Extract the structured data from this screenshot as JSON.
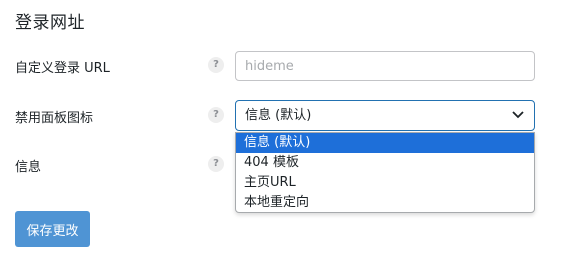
{
  "section": {
    "title": "登录网址"
  },
  "fields": {
    "custom_login": {
      "label": "自定义登录 URL",
      "help": "?",
      "placeholder": "hideme",
      "value": ""
    },
    "disabled_panel": {
      "label": "禁用面板图标",
      "help": "?",
      "selected": "信息 (默认)"
    },
    "info": {
      "label": "信息",
      "help": "?"
    }
  },
  "dropdown": {
    "options": [
      "信息 (默认)",
      "404 模板",
      "主页URL",
      "本地重定向"
    ]
  },
  "actions": {
    "save_label": "保存更改"
  },
  "colors": {
    "accent": "#2271b1",
    "selected_option": "#1e6fd9",
    "button": "#4f94d4"
  }
}
